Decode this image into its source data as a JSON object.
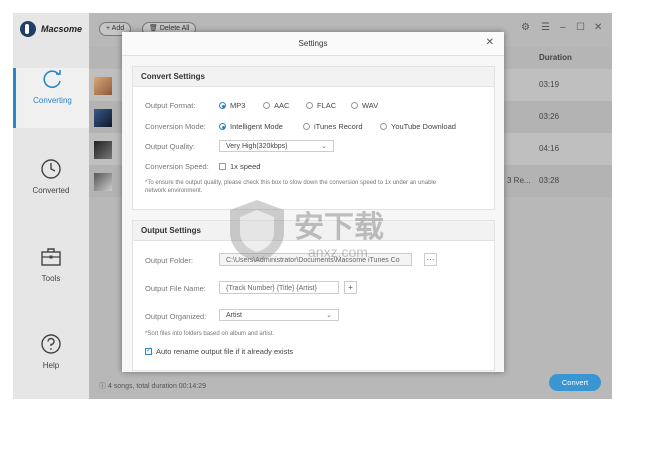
{
  "app": {
    "name": "Macsome"
  },
  "sidebar": {
    "items": [
      {
        "label": "Converting",
        "icon": "refresh-icon"
      },
      {
        "label": "Converted",
        "icon": "clock-icon"
      },
      {
        "label": "Tools",
        "icon": "toolbox-icon"
      },
      {
        "label": "Help",
        "icon": "question-icon"
      }
    ]
  },
  "toolbar": {
    "add_label": "Add",
    "delete_all_label": "Delete All"
  },
  "table": {
    "duration_header": "Duration",
    "rows": [
      {
        "duration": "03:19",
        "extra": ""
      },
      {
        "duration": "03:26",
        "extra": ""
      },
      {
        "duration": "04:16",
        "extra": ""
      },
      {
        "duration": "03:28",
        "extra": "3 Re..."
      }
    ]
  },
  "footer": {
    "info": "4 songs, total duration 00:14:29",
    "convert_label": "Convert"
  },
  "settings": {
    "title": "Settings",
    "convert": {
      "heading": "Convert Settings",
      "format_label": "Output Format:",
      "formats": [
        "MP3",
        "AAC",
        "FLAC",
        "WAV"
      ],
      "selected_format": "MP3",
      "mode_label": "Conversion Mode:",
      "modes": [
        "Intelligent Mode",
        "iTunes Record",
        "YouTube Download"
      ],
      "selected_mode": "Intelligent Mode",
      "quality_label": "Output Quality:",
      "quality_value": "Very High(320kbps)",
      "speed_label": "Conversion Speed:",
      "speed_option": "1x speed",
      "speed_checked": false,
      "note_line1": "*To ensure the output quality, please check this box to slow down the conversion speed to 1x under an unable",
      "note_line2": "network environment."
    },
    "output": {
      "heading": "Output Settings",
      "folder_label": "Output Folder:",
      "folder_value": "C:\\Users\\Administrator\\Documents\\Macsome iTunes Co",
      "folder_btn": "···",
      "filename_label": "Output File Name:",
      "filename_value": "{Track Number} {Title} {Artist}",
      "filename_btn": "+",
      "organized_label": "Output Organized:",
      "organized_value": "Artist",
      "organized_note": "*Sort files into folders based on album and artist.",
      "rename_label": "Auto rename output file if it already exists",
      "rename_checked": true
    }
  },
  "watermark": {
    "text_cn": "安下载",
    "text_en": "anxz.com"
  }
}
